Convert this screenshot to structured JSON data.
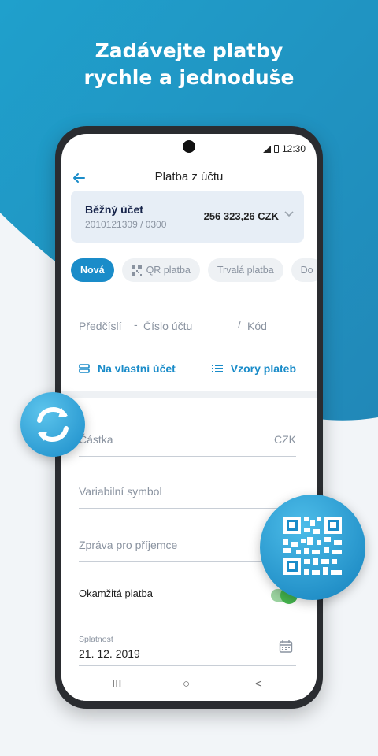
{
  "headline": {
    "line1": "Zadávejte platby",
    "line2": "rychle a jednoduše"
  },
  "colors": {
    "accent": "#1a8cc9",
    "toggle_on": "#45b54e",
    "background_blue": "#2a9bc7"
  },
  "status_bar": {
    "time": "12:30"
  },
  "appbar": {
    "title": "Platba z účtu",
    "back_icon": "arrow-left-icon"
  },
  "account": {
    "name": "Běžný účet",
    "number": "2010121309 / 0300",
    "balance": "256 323,26 CZK"
  },
  "tabs": [
    {
      "label": "Nová",
      "active": true
    },
    {
      "label": "QR platba",
      "icon": "qr-icon"
    },
    {
      "label": "Trvalá platba"
    },
    {
      "label": "Do"
    }
  ],
  "recipient": {
    "prefix_placeholder": "Předčíslí",
    "dash": "-",
    "account_placeholder": "Číslo účtu",
    "slash": "/",
    "code_placeholder": "Kód"
  },
  "links": {
    "own_account": "Na vlastní účet",
    "templates": "Vzory plateb"
  },
  "form": {
    "amount_label": "Částka",
    "currency": "CZK",
    "variable_symbol": "Variabilní symbol",
    "message": "Zpráva pro příjemce",
    "instant_payment": "Okamžitá platba",
    "instant_on": true,
    "due_caption": "Splatnost",
    "due_value": "21. 12. 2019"
  },
  "navbar": {
    "recent": "III",
    "home": "○",
    "back": "<"
  }
}
